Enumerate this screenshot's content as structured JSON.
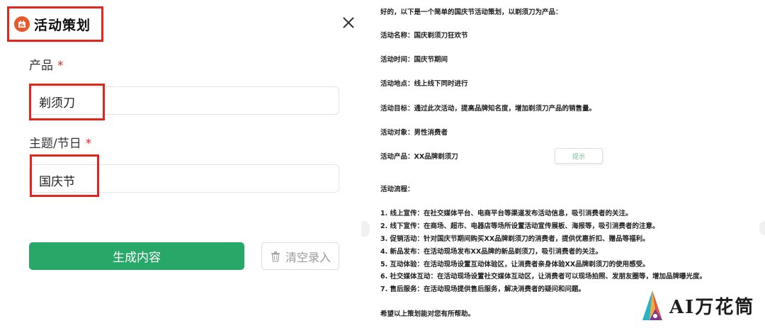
{
  "form": {
    "title": "活动策划",
    "product_label": "产品",
    "product_value": "剃须刀",
    "theme_label": "主题/节日",
    "theme_value": "国庆节",
    "required_mark": "*",
    "generate_label": "生成内容",
    "clear_label": "清空录入"
  },
  "output": {
    "lines": [
      "好的，以下是一个简单的国庆节活动策划，以剃须刀为产品：",
      "活动名称：国庆剃须刀狂欢节",
      "活动时间：国庆节期间",
      "活动地点：线上线下同时进行",
      "活动目标：通过此次活动，提高品牌知名度，增加剃须刀产品的销售量。",
      "活动对象：男性消费者",
      "活动产品：XX品牌剃须刀",
      "活动流程：",
      "1. 线上宣传：在社交媒体平台、电商平台等渠道发布活动信息，吸引消费者的关注。",
      "2. 线下宣传：在商场、超市、电器店等场所设置活动宣传展板、海报等，吸引消费者的注意。",
      "3. 促销活动：针对国庆节期间购买XX品牌剃须刀的消费者，提供优惠折扣、赠品等福利。",
      "4. 新品发布：在活动现场发布XX品牌的新品剃须刀，吸引消费者的关注。",
      "5. 互动体验：在活动现场设置互动体验区，让消费者亲身体验XX品牌剃须刀的使用感受。",
      "6. 社交媒体互动：在活动现场设置社交媒体互动区，让消费者可以现场拍照、发朋友圈等，增加品牌曝光度。",
      "7. 售后服务：在活动现场提供售后服务，解决消费者的疑问和问题。",
      "希望以上策划能对您有所帮助。"
    ],
    "pill_label": "提示"
  },
  "watermark": {
    "text": "AI万花筒"
  },
  "colors": {
    "accent_green": "#27a869",
    "highlight_red": "#e0261f",
    "icon_orange": "#e9582b"
  }
}
